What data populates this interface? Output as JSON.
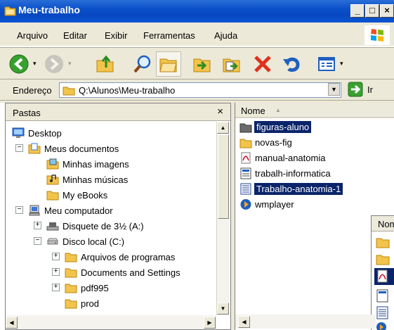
{
  "window": {
    "title": "Meu-trabalho",
    "buttons": {
      "minimize": "_",
      "maximize": "□",
      "close": "×"
    }
  },
  "menu": [
    "Arquivo",
    "Editar",
    "Exibir",
    "Ferramentas",
    "Ajuda"
  ],
  "toolbar": {
    "buttons": [
      "back-icon",
      "forward-icon",
      "up-folder-icon",
      "search-icon",
      "folders-icon",
      "move-to-icon",
      "copy-to-icon",
      "delete-icon",
      "undo-icon",
      "views-icon"
    ]
  },
  "address": {
    "label": "Endereço",
    "value": "Q:\\Alunos\\Meu-trabalho",
    "go_label": "Ir"
  },
  "folders_pane": {
    "title": "Pastas",
    "close": "×",
    "tree": [
      {
        "label": "Desktop",
        "icon": "desktop-icon"
      },
      {
        "label": "Meus documentos",
        "icon": "my-documents-icon"
      },
      {
        "label": "Minhas imagens",
        "icon": "my-pictures-icon"
      },
      {
        "label": "Minhas músicas",
        "icon": "my-music-icon"
      },
      {
        "label": "My eBooks",
        "icon": "folder-icon"
      },
      {
        "label": "Meu computador",
        "icon": "my-computer-icon"
      },
      {
        "label": "Disquete de 3½ (A:)",
        "icon": "floppy-drive-icon"
      },
      {
        "label": "Disco local (C:)",
        "icon": "hard-drive-icon"
      },
      {
        "label": "Arquivos de programas",
        "icon": "folder-icon"
      },
      {
        "label": "Documents and Settings",
        "icon": "folder-icon"
      },
      {
        "label": "pdf995",
        "icon": "folder-icon"
      },
      {
        "label": "prod",
        "icon": "folder-icon"
      }
    ]
  },
  "file_list": {
    "column": "Nome",
    "items": [
      {
        "label": "figuras-aluno",
        "icon": "folder-icon",
        "selected": true
      },
      {
        "label": "novas-fig",
        "icon": "folder-icon",
        "selected": false
      },
      {
        "label": "manual-anatomia",
        "icon": "pdf-file-icon",
        "selected": false
      },
      {
        "label": "trabalh-informatica",
        "icon": "document-file-icon",
        "selected": false
      },
      {
        "label": "Trabalho-anatomia-1",
        "icon": "word-file-icon",
        "selected": true
      },
      {
        "label": "wmplayer",
        "icon": "media-player-icon",
        "selected": false
      }
    ],
    "drag_ghost_header": "Nom"
  },
  "colors": {
    "titlebar": "#0a4fc9",
    "chrome": "#ece9d8",
    "selection": "#0a246a",
    "folder": "#f3c44b"
  }
}
